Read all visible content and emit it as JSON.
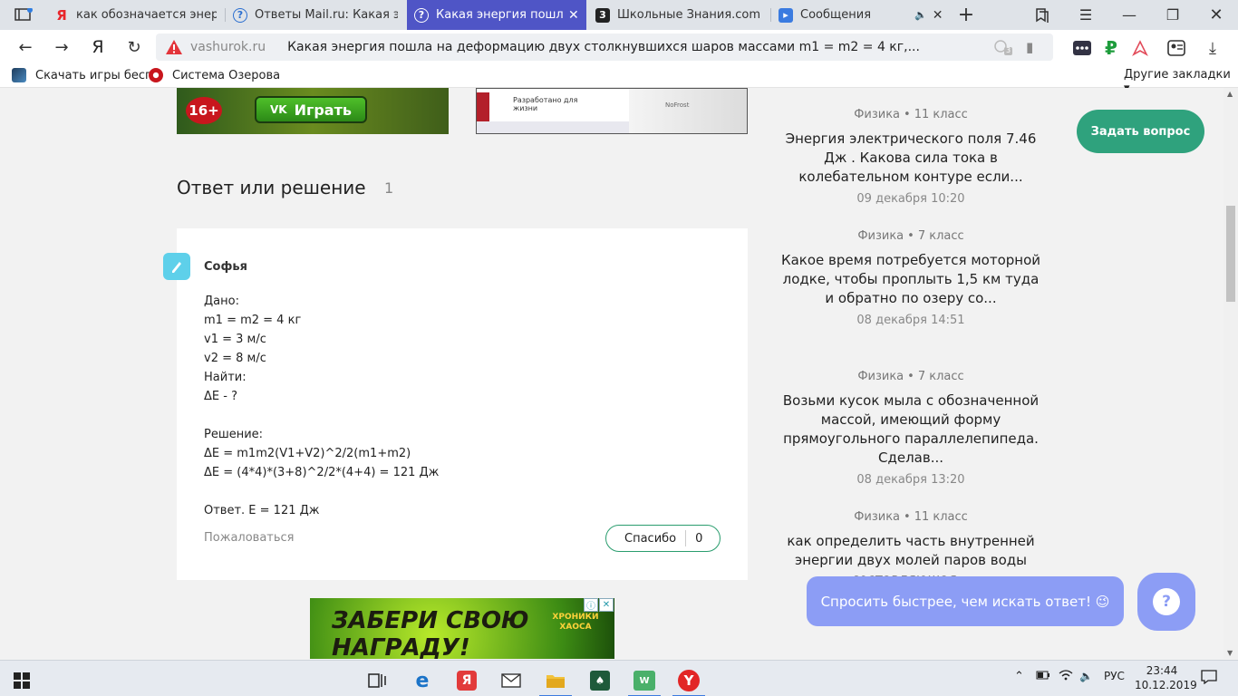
{
  "browser": {
    "tabs": [
      {
        "title": "как обозначается энергия",
        "active": false,
        "favicon": "yandex-icon"
      },
      {
        "title": "Ответы Mail.ru: Какая энер",
        "active": false,
        "favicon": "question-icon"
      },
      {
        "title": "Какая энергия пошла на",
        "active": true,
        "favicon": "question-icon"
      },
      {
        "title": "Школьные Знания.com - Р",
        "active": false,
        "favicon": "znanija-icon"
      },
      {
        "title": "Сообщения",
        "active": false,
        "favicon": "messages-icon"
      }
    ],
    "url_host": "vashurok.ru",
    "page_title": "Какая энергия пошла на деформацию двух столкнувшихся шаров массами m1 = m2 = 4 кг,...",
    "ext_badge": "3",
    "ext_currency": "₽",
    "bookmarks": [
      {
        "label": "Скачать игры бесп"
      },
      {
        "label": "Система Озерова"
      }
    ],
    "other_bookmarks": "Другие закладки ▾"
  },
  "ads": {
    "age": "16+",
    "play": "Играть",
    "bosch_tagline": "Разработано для жизни",
    "fridge_label": "NoFrost",
    "bottom_text_1": "ЗАБЕРИ СВОЮ",
    "bottom_text_2": "НАГРАДУ!",
    "bottom_logo_1": "ХРОНИКИ",
    "bottom_logo_2": "ХАОСА"
  },
  "answers": {
    "title": "Ответ или решение",
    "count": "1",
    "author": "Софья",
    "lines": [
      "Дано:",
      "m1 = m2 = 4 кг",
      "v1 = 3 м/с",
      "v2 = 8 м/с",
      "Найти:",
      "ΔE - ?",
      "",
      "Решение:",
      "ΔE = m1m2(V1+V2)^2/2(m1+m2)",
      "ΔE = (4*4)*(3+8)^2/2*(4+4) = 121 Дж",
      "",
      "Ответ. E = 121 Дж"
    ],
    "report": "Пожаловаться",
    "thanks": "Спасибо",
    "thanks_count": "0"
  },
  "sidebar": {
    "ask_button": "Задать вопрос",
    "questions": [
      {
        "subject": "Физика",
        "grade": "11 класс",
        "title": "Энергия электрического поля 7.46 Дж . Какова сила тока в колебательном контуре если...",
        "date": "09 декабря 10:20"
      },
      {
        "subject": "Физика",
        "grade": "7 класс",
        "title": "Какое время потребуется моторной лодке, чтобы проплыть 1,5 км туда и обратно по озеру со...",
        "date": "08 декабря 14:51"
      },
      {
        "subject": "Физика",
        "grade": "7 класс",
        "title": "Возьми кусок мыла с обозначенной массой, имеющий форму прямоугольного параллелепипеда. Сделав...",
        "date": "08 декабря 13:20"
      },
      {
        "subject": "Физика",
        "grade": "11 класс",
        "title": "как определить часть внутренней энергии двух молей паров воды составляющая...",
        "date": ""
      }
    ],
    "fast_button": "Спросить быстрее, чем искать ответ! 😉",
    "help_button": "?"
  },
  "taskbar": {
    "lang": "РУС",
    "time": "23:44",
    "date": "10.12.2019"
  }
}
